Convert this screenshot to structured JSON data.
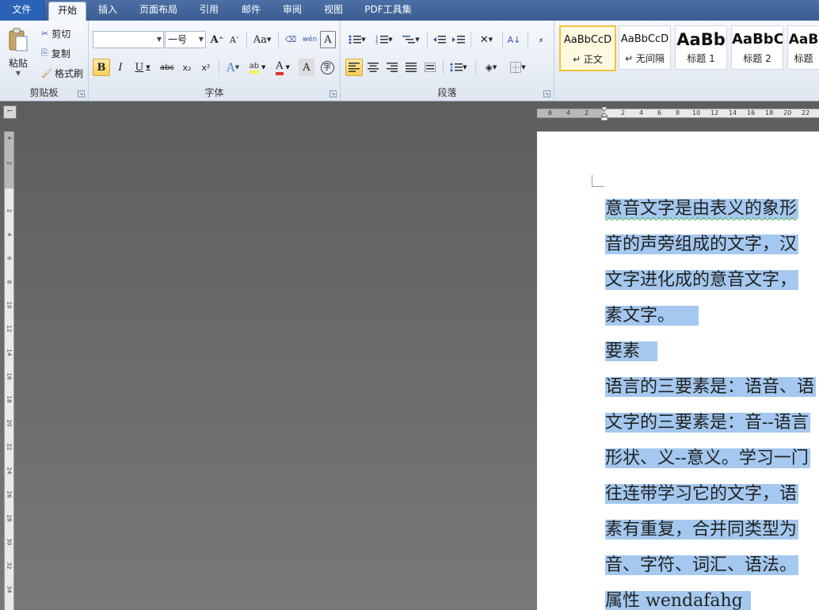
{
  "tabs": [
    {
      "label": "文件"
    },
    {
      "label": "开始"
    },
    {
      "label": "插入"
    },
    {
      "label": "页面布局"
    },
    {
      "label": "引用"
    },
    {
      "label": "邮件"
    },
    {
      "label": "审阅"
    },
    {
      "label": "视图"
    },
    {
      "label": "PDF工具集"
    }
  ],
  "clipboard": {
    "paste": "粘贴",
    "cut": "剪切",
    "copy": "复制",
    "format_painter": "格式刷",
    "label": "剪贴板"
  },
  "font": {
    "family_value": "",
    "size_value": "一号",
    "label": "字体",
    "grow": "A",
    "shrink": "A",
    "case": "Aa",
    "bold": "B",
    "italic": "I",
    "underline": "U",
    "strike": "abc",
    "subscript": "x₂",
    "superscript": "x²",
    "text_effect": "A",
    "highlight": "ab",
    "font_color": "A",
    "char_shading": "A",
    "enclose": "字",
    "phonetic": "wén",
    "border": "A"
  },
  "paragraph": {
    "label": "段落"
  },
  "styles": [
    {
      "sample": "AaBbCcD",
      "name": "↵ 正文"
    },
    {
      "sample": "AaBbCcD",
      "name": "↵ 无间隔"
    },
    {
      "sample": "AaBb",
      "name": "标题 1"
    },
    {
      "sample": "AaBbC",
      "name": "标题 2"
    },
    {
      "sample": "AaB",
      "name": "标题"
    }
  ],
  "ruler": {
    "h_numbers": [
      "6",
      "4",
      "2",
      "2",
      "4",
      "6",
      "8",
      "10",
      "12",
      "14",
      "16",
      "18",
      "20",
      "22"
    ],
    "v_numbers": [
      "4",
      "2",
      "2",
      "4",
      "6",
      "8",
      "10",
      "12",
      "14",
      "16",
      "18",
      "20",
      "22",
      "24",
      "26",
      "28",
      "30",
      "32",
      "34"
    ]
  },
  "document": {
    "lines": [
      "意音文字是由表义的象形",
      "音的声旁组成的文字，汉",
      "文字进化成的意音文字，",
      "素文字。",
      "要素",
      "语言的三要素是：语音、语",
      "文字的三要素是：音--语言",
      "形状、义--意义。学习一门",
      "往连带学习它的文字，语",
      "素有重复，合并同类型为",
      "音、字符、词汇、语法。",
      "属性 wendafahg"
    ]
  },
  "colors": {
    "selection": "#a4c8ef",
    "tabbar": "#3b5d92",
    "file_tab": "#2a62b8"
  }
}
